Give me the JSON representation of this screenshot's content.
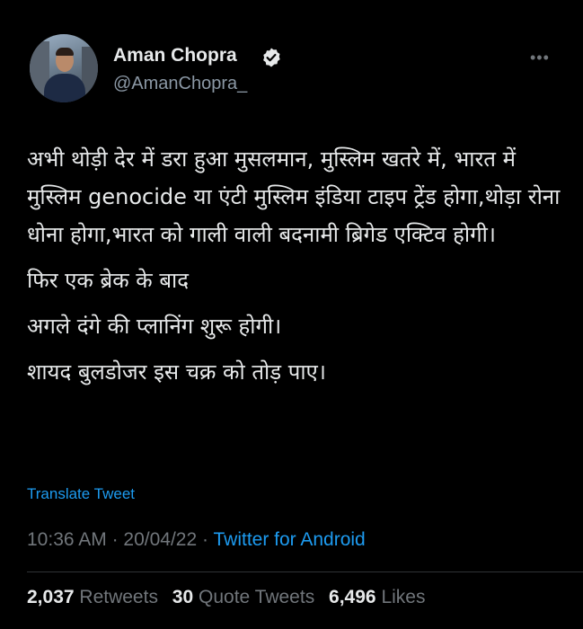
{
  "author": {
    "display_name": "Aman Chopra",
    "handle": "@AmanChopra_",
    "verified": true,
    "avatar_icon": "profile-photo"
  },
  "more_icon": "more-dots-icon",
  "tweet": {
    "paragraphs": [
      "अभी थोड़ी देर में डरा हुआ मुसलमान, मुस्लिम खतरे में, भारत में मुस्लिम genocide या एंटी मुस्लिम इंडिया टाइप ट्रेंड होगा,थोड़ा रोना धोना होगा,भारत को गाली वाली बदनामी ब्रिगेड एक्टिव होगी।",
      "फिर एक ब्रेक के बाद",
      "अगले दंगे की प्लानिंग शुरू होगी।",
      "शायद बुलडोजर इस चक्र को तोड़ पाए।"
    ],
    "translate_label": "Translate Tweet",
    "time": "10:36 AM",
    "date": "20/04/22",
    "separator": "·",
    "source": "Twitter for Android"
  },
  "stats": {
    "retweets_count": "2,037",
    "retweets_label": "Retweets",
    "quotes_count": "30",
    "quotes_label": "Quote Tweets",
    "likes_count": "6,496",
    "likes_label": "Likes"
  },
  "colors": {
    "background": "#000000",
    "text": "#e7e9ea",
    "muted": "#71767b",
    "accent": "#1d9bf0"
  }
}
